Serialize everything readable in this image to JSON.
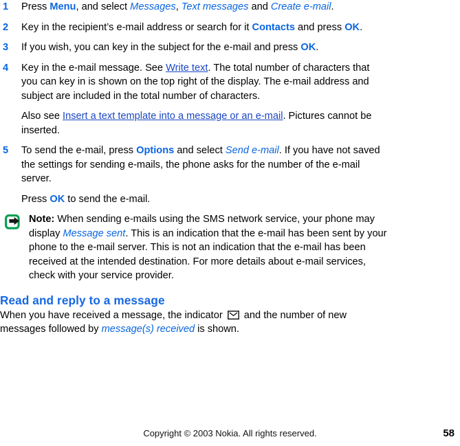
{
  "document": {
    "type": "user-guide-page",
    "colors": {
      "accent_blue": "#0a66e0",
      "heading_blue": "#1668e3",
      "link_blue": "#1a47c2",
      "note_icon_green": "#00a050",
      "text_black": "#000000",
      "background": "#ffffff"
    }
  },
  "steps": [
    {
      "number": "1",
      "parts": [
        {
          "t": "Press ",
          "style": "plain"
        },
        {
          "t": "Menu",
          "style": "ui"
        },
        {
          "t": ", and select ",
          "style": "plain"
        },
        {
          "t": "Messages",
          "style": "ui-italic"
        },
        {
          "t": ", ",
          "style": "plain"
        },
        {
          "t": "Text messages",
          "style": "ui-italic"
        },
        {
          "t": " and ",
          "style": "plain"
        },
        {
          "t": "Create e-mail",
          "style": "ui-italic"
        },
        {
          "t": ".",
          "style": "plain"
        }
      ]
    },
    {
      "number": "2",
      "parts": [
        {
          "t": "Key in the recipient’s e-mail address or search for it ",
          "style": "plain"
        },
        {
          "t": "Contacts",
          "style": "ui"
        },
        {
          "t": " and press ",
          "style": "plain"
        },
        {
          "t": "OK",
          "style": "ui"
        },
        {
          "t": ".",
          "style": "plain"
        }
      ]
    },
    {
      "number": "3",
      "parts": [
        {
          "t": "If you wish, you can key in the subject for the e-mail and press ",
          "style": "plain"
        },
        {
          "t": "OK",
          "style": "ui"
        },
        {
          "t": ".",
          "style": "plain"
        }
      ]
    },
    {
      "number": "4",
      "parts": [
        {
          "t": "Key in the e-mail message. See ",
          "style": "plain"
        },
        {
          "t": "Write text",
          "style": "link"
        },
        {
          "t": ". The total number of characters that you can key in is shown on the top right of the display. The e-mail address and subject are included in the total number of characters.",
          "style": "plain"
        }
      ],
      "sub_paragraph": [
        {
          "t": "Also see ",
          "style": "plain"
        },
        {
          "t": "Insert a text template into a message or an e-mail",
          "style": "link"
        },
        {
          "t": ". Pictures cannot be inserted.",
          "style": "plain"
        }
      ]
    },
    {
      "number": "5",
      "parts": [
        {
          "t": "To send the e-mail, press ",
          "style": "plain"
        },
        {
          "t": "Options",
          "style": "ui"
        },
        {
          "t": " and select ",
          "style": "plain"
        },
        {
          "t": "Send e-mail",
          "style": "ui-italic"
        },
        {
          "t": ". If you have not saved the settings for sending e-mails, the phone asks for the number of the e-mail server.",
          "style": "plain"
        }
      ],
      "sub_paragraph": [
        {
          "t": "Press ",
          "style": "plain"
        },
        {
          "t": "OK",
          "style": "ui"
        },
        {
          "t": " to send the e-mail.",
          "style": "plain"
        }
      ]
    }
  ],
  "note": {
    "icon_name": "note-arrow-icon",
    "parts": [
      {
        "t": "Note:",
        "style": "bold"
      },
      {
        "t": " When sending e-mails using the SMS network service, your phone may display ",
        "style": "plain"
      },
      {
        "t": "Message sent",
        "style": "ui-italic"
      },
      {
        "t": ". This is an indication that the e-mail has been sent by your phone to the e-mail server. This is not an indication that the e-mail has been received at the intended destination. For more details about e-mail services, check with your service provider.",
        "style": "plain"
      }
    ]
  },
  "section": {
    "heading": "Read and reply to a message",
    "body_parts": [
      {
        "t": "When you have received a message, the indicator ",
        "style": "plain"
      },
      {
        "t": "",
        "style": "envelope-icon"
      },
      {
        "t": " and the number of new messages followed by ",
        "style": "plain"
      },
      {
        "t": "message(s) received",
        "style": "ui-italic"
      },
      {
        "t": " is shown.",
        "style": "plain"
      }
    ]
  },
  "footer": {
    "copyright": "Copyright © 2003 Nokia. All rights reserved.",
    "page_number": "58"
  }
}
